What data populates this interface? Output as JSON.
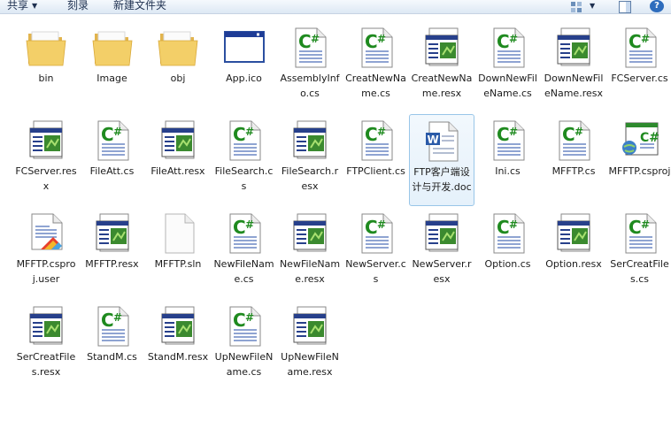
{
  "toolbar": {
    "share_label": "共享",
    "burn_label": "刻录",
    "new_folder_label": "新建文件夹"
  },
  "files": [
    {
      "label": "bin",
      "icon": "folder-icon"
    },
    {
      "label": "Image",
      "icon": "folder-icon"
    },
    {
      "label": "obj",
      "icon": "folder-icon"
    },
    {
      "label": "App.ico",
      "icon": "ico-file-icon"
    },
    {
      "label": "AssemblyInfo.cs",
      "icon": "csharp-file-icon"
    },
    {
      "label": "CreatNewName.cs",
      "icon": "csharp-file-icon"
    },
    {
      "label": "CreatNewName.resx",
      "icon": "resx-file-icon"
    },
    {
      "label": "DownNewFileName.cs",
      "icon": "csharp-file-icon"
    },
    {
      "label": "DownNewFileName.resx",
      "icon": "resx-file-icon"
    },
    {
      "label": "FCServer.cs",
      "icon": "csharp-file-icon"
    },
    {
      "label": "FCServer.resx",
      "icon": "resx-file-icon"
    },
    {
      "label": "FileAtt.cs",
      "icon": "csharp-file-icon"
    },
    {
      "label": "FileAtt.resx",
      "icon": "resx-file-icon"
    },
    {
      "label": "FileSearch.cs",
      "icon": "csharp-file-icon"
    },
    {
      "label": "FileSearch.resx",
      "icon": "resx-file-icon"
    },
    {
      "label": "FTPClient.cs",
      "icon": "csharp-file-icon"
    },
    {
      "label": "FTP客户端设计与开发.doc",
      "icon": "word-doc-icon",
      "selected": true
    },
    {
      "label": "Ini.cs",
      "icon": "csharp-file-icon"
    },
    {
      "label": "MFFTP.cs",
      "icon": "csharp-file-icon"
    },
    {
      "label": "MFFTP.csproj",
      "icon": "csproj-file-icon"
    },
    {
      "label": "MFFTP.csproj.user",
      "icon": "csproj-user-icon"
    },
    {
      "label": "MFFTP.resx",
      "icon": "resx-file-icon"
    },
    {
      "label": "MFFTP.sln",
      "icon": "blank-file-icon"
    },
    {
      "label": "NewFileName.cs",
      "icon": "csharp-file-icon"
    },
    {
      "label": "NewFileName.resx",
      "icon": "resx-file-icon"
    },
    {
      "label": "NewServer.cs",
      "icon": "csharp-file-icon"
    },
    {
      "label": "NewServer.resx",
      "icon": "resx-file-icon"
    },
    {
      "label": "Option.cs",
      "icon": "csharp-file-icon"
    },
    {
      "label": "Option.resx",
      "icon": "resx-file-icon"
    },
    {
      "label": "SerCreatFiles.cs",
      "icon": "csharp-file-icon"
    },
    {
      "label": "SerCreatFiles.resx",
      "icon": "resx-file-icon"
    },
    {
      "label": "StandM.cs",
      "icon": "csharp-file-icon"
    },
    {
      "label": "StandM.resx",
      "icon": "resx-file-icon"
    },
    {
      "label": "UpNewFileName.cs",
      "icon": "csharp-file-icon"
    },
    {
      "label": "UpNewFileName.resx",
      "icon": "resx-file-icon"
    }
  ]
}
